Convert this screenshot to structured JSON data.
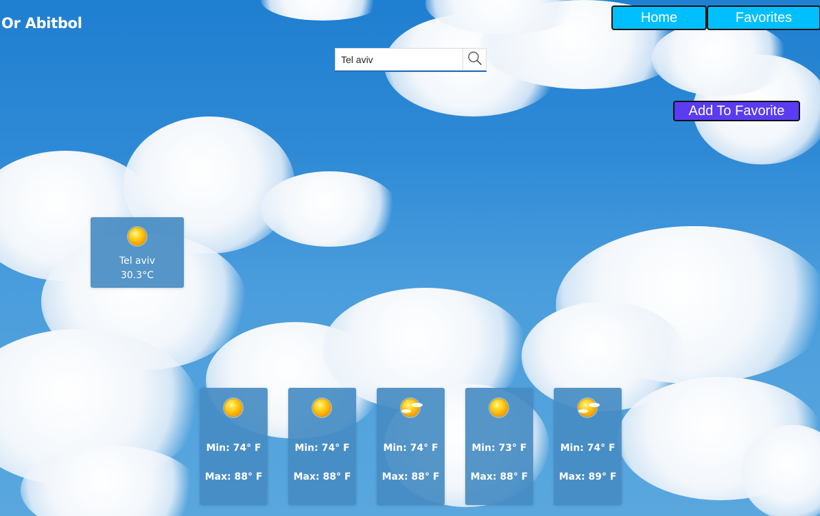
{
  "app": {
    "title": "Or Abitbol"
  },
  "nav": {
    "home_label": "Home",
    "favorites_label": "Favorites"
  },
  "search": {
    "value": "Tel aviv",
    "icon": "search-icon"
  },
  "favorite_button": {
    "label": "Add To Favorite"
  },
  "current": {
    "city": "Tel aviv",
    "temperature": "30.3°C",
    "icon": "sun-icon"
  },
  "forecast": [
    {
      "min": "Min: 74° F",
      "max": "Max: 88° F",
      "icon": "sun-icon"
    },
    {
      "min": "Min: 74° F",
      "max": "Max: 88° F",
      "icon": "sun-icon"
    },
    {
      "min": "Min: 74° F",
      "max": "Max: 88° F",
      "icon": "partly-sunny-icon"
    },
    {
      "min": "Min: 73° F",
      "max": "Max: 88° F",
      "icon": "sun-icon"
    },
    {
      "min": "Min: 74° F",
      "max": "Max: 89° F",
      "icon": "partly-sunny-icon"
    }
  ],
  "colors": {
    "nav_button": "#00bfff",
    "favorite_button": "#5b3cf0",
    "card": "#468cc3",
    "sky": "#2f8ad6"
  }
}
